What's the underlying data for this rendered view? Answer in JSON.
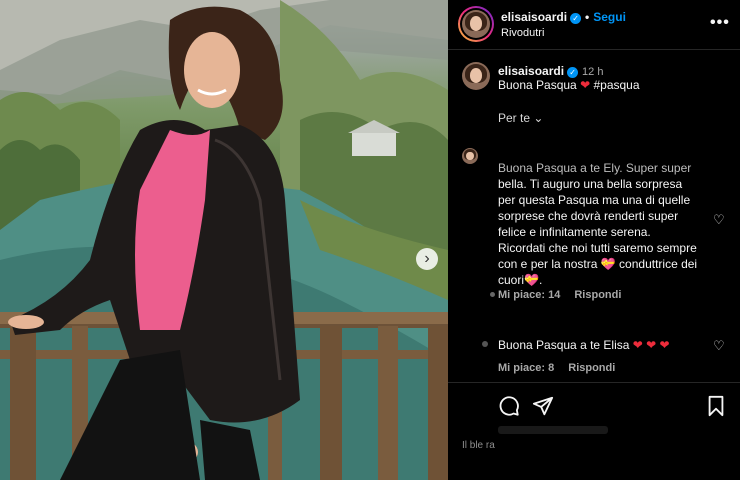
{
  "post": {
    "header": {
      "username": "elisaisoardi",
      "follow_label": "Segui",
      "subtitle": "Rivodutri",
      "more_icon": "more-horizontal-icon"
    },
    "caption": {
      "username": "elisaisoardi",
      "time": "12 h",
      "text_before": "Buona Pasqua",
      "hashtag": "#pasqua"
    },
    "sort_label": "Per te",
    "comments": [
      {
        "lines": [
          "Buona Pasqua a te Ely. Super super",
          "bella. Ti auguro una bella sorpresa",
          "per questa Pasqua ma una di quelle",
          "sorprese che dovrà renderti super",
          "felice e infinitamente serena.",
          "Ricordati che noi tutti saremo sempre",
          "con e per la nostra",
          "conduttrice dei",
          "cuori"
        ],
        "likes_label": "Mi piace: 14",
        "reply_label": "Rispondi"
      },
      {
        "text": "Buona Pasqua a te Elisa",
        "likes_label": "Mi piace: 8",
        "reply_label": "Rispondi"
      }
    ],
    "footer_text": "Il ble ra",
    "colors": {
      "accent_blue": "#0095f6",
      "heart_red": "#ed2c3b",
      "background": "#000000"
    }
  }
}
